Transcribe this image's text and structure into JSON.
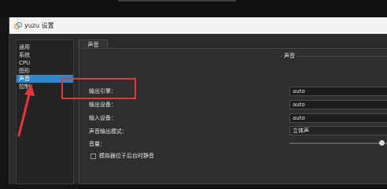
{
  "window": {
    "title": "yuzu 设置"
  },
  "sidebar": {
    "items": [
      {
        "label": "通用"
      },
      {
        "label": "系统"
      },
      {
        "label": "CPU"
      },
      {
        "label": "图形"
      },
      {
        "label": "声音",
        "active": true
      },
      {
        "label": "控制"
      }
    ]
  },
  "tabs": [
    {
      "label": "声音"
    }
  ],
  "audio": {
    "group_title": "声音",
    "output_engine_label": "输出引擎：",
    "output_engine_value": "auto",
    "output_device_label": "输出设备：",
    "output_device_value": "auto",
    "input_device_label": "输入设备：",
    "input_device_value": "auto",
    "output_mode_label": "声音输出模式：",
    "output_mode_value": "立体声",
    "volume_label": "音量：",
    "volume_level": 0.93,
    "mute_background_label": "模拟器位于后台时静音",
    "mute_background_checked": false
  },
  "annotations": {
    "highlight_color": "#e6353b",
    "arrow_color": "#e6353b"
  }
}
